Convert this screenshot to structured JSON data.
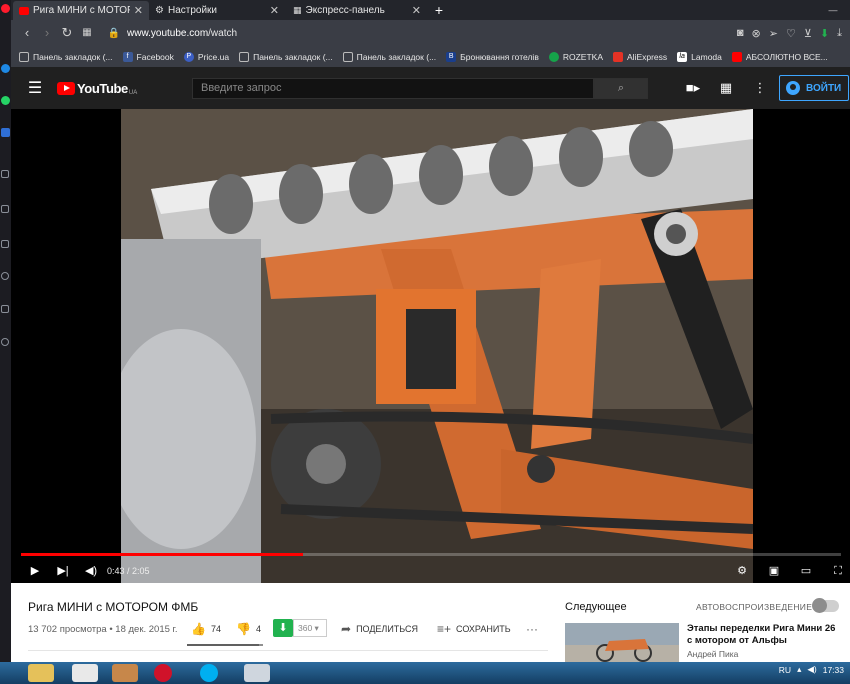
{
  "browser": {
    "tabs": [
      {
        "title": "Рига МИНИ с МОТОРОМ",
        "active": true
      },
      {
        "title": "Настройки",
        "active": false
      },
      {
        "title": "Экспресс-панель",
        "active": false
      }
    ],
    "new_tab": "+",
    "url_host": "www.youtube.com",
    "url_path": "/watch",
    "bookmarks": [
      {
        "label": "Панель закладок (..."
      },
      {
        "label": "Facebook"
      },
      {
        "label": "Price.ua"
      },
      {
        "label": "Панель закладок (..."
      },
      {
        "label": "Панель закладок (..."
      },
      {
        "label": "Бронювання готелів"
      },
      {
        "label": "ROZETKA"
      },
      {
        "label": "AliExpress"
      },
      {
        "label": "Lamoda"
      },
      {
        "label": "АБСОЛЮТНО ВСЕ..."
      }
    ]
  },
  "youtube": {
    "logo_text": "YouTube",
    "logo_region": "UA",
    "search_placeholder": "Введите запрос",
    "signin_label": "ВОЙТИ",
    "accent": "#ff0000"
  },
  "player": {
    "current_time": "0:43",
    "duration": "2:05",
    "time_display": "0:43 / 2:05",
    "progress_fraction": 0.344
  },
  "video": {
    "title": "Рига МИНИ с МОТОРОМ ФМБ",
    "meta": "13 702 просмотра • 18 дек. 2015 г.",
    "likes": "74",
    "dislikes": "4",
    "download_count": "360",
    "share_label": "ПОДЕЛИТЬСЯ",
    "save_label": "СОХРАНИТЬ",
    "like_fraction": 0.95
  },
  "upnext": {
    "label": "Следующее",
    "autoplay_label": "АВТОВОСПРОИЗВЕДЕНИЕ",
    "item": {
      "title": "Этапы переделки Рига Мини 26 с мотором от Альфы",
      "channel": "Андрей Пика"
    }
  },
  "taskbar": {
    "lang": "RU",
    "clock": "17:33"
  }
}
